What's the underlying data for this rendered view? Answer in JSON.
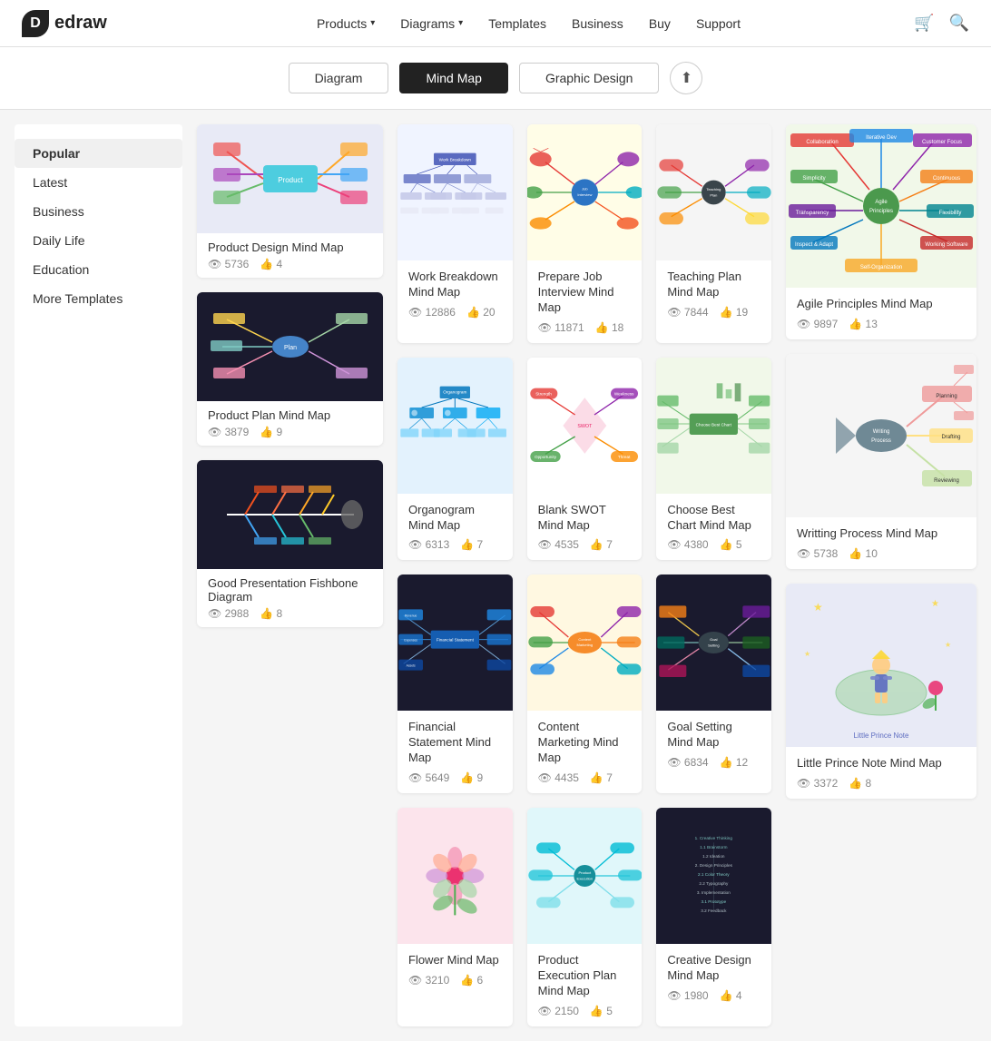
{
  "nav": {
    "logo_text": "edraw",
    "items": [
      {
        "label": "Products",
        "has_chevron": true
      },
      {
        "label": "Diagrams",
        "has_chevron": true
      },
      {
        "label": "Templates",
        "has_chevron": false
      },
      {
        "label": "Business",
        "has_chevron": false
      },
      {
        "label": "Buy",
        "has_chevron": false
      },
      {
        "label": "Support",
        "has_chevron": false
      }
    ]
  },
  "toolbar": {
    "buttons": [
      {
        "label": "Diagram",
        "active": false
      },
      {
        "label": "Mind Map",
        "active": true
      },
      {
        "label": "Graphic Design",
        "active": false
      }
    ],
    "upload_label": "⬆"
  },
  "sidebar": {
    "items": [
      {
        "label": "Popular",
        "active": true
      },
      {
        "label": "Latest",
        "active": false
      },
      {
        "label": "Business",
        "active": false
      },
      {
        "label": "Daily Life",
        "active": false
      },
      {
        "label": "Education",
        "active": false
      },
      {
        "label": "More Templates",
        "active": false
      }
    ]
  },
  "left_cards": [
    {
      "title": "Product Design Mind Map",
      "views": "5736",
      "likes": "4",
      "bg": "#e8eaf6",
      "style": "colorful-branches"
    },
    {
      "title": "Product Plan Mind Map",
      "views": "3879",
      "likes": "9",
      "bg": "#1a1a2e",
      "style": "dark-fishbone"
    },
    {
      "title": "Good Presentation Fishbone Diagram",
      "views": "2988",
      "likes": "8",
      "bg": "#1a1a2e",
      "style": "fishbone"
    }
  ],
  "main_cards": [
    {
      "title": "Work Breakdown Mind Map",
      "views": "12886",
      "likes": "20",
      "bg": "#f0f4ff",
      "style": "hierarchy-blue"
    },
    {
      "title": "Prepare Job Interview Mind Map",
      "views": "11871",
      "likes": "18",
      "bg": "#fff8e1",
      "style": "radial-colorful"
    },
    {
      "title": "Teaching Plan Mind Map",
      "views": "7844",
      "likes": "19",
      "bg": "#f5f5f5",
      "style": "radial-dark"
    },
    {
      "title": "Organogram Mind Map",
      "views": "6313",
      "likes": "7",
      "bg": "#e8f4fd",
      "style": "org-blue"
    },
    {
      "title": "Blank SWOT Mind Map",
      "views": "4535",
      "likes": "7",
      "bg": "#fce4ec",
      "style": "swot-pink"
    },
    {
      "title": "Choose Best Chart Mind Map",
      "views": "4380",
      "likes": "5",
      "bg": "#e8f5e9",
      "style": "chart-green"
    },
    {
      "title": "Financial Statement Mind Map",
      "views": "5649",
      "likes": "9",
      "bg": "#1a1a2e",
      "style": "financial-dark"
    },
    {
      "title": "Content Marketing Mind Map",
      "views": "4435",
      "likes": "7",
      "bg": "#fff3e0",
      "style": "marketing-colorful"
    },
    {
      "title": "Goal Setting Mind Map",
      "views": "6834",
      "likes": "12",
      "bg": "#1a1a2e",
      "style": "goal-dark"
    },
    {
      "title": "Flower Mind Map",
      "views": "3210",
      "likes": "6",
      "bg": "#fce4ec",
      "style": "flower"
    },
    {
      "title": "Product Execution Plan Mind Map",
      "views": "2150",
      "likes": "5",
      "bg": "#e0f7fa",
      "style": "execution-teal"
    },
    {
      "title": "Creative Design Mind Map",
      "views": "1980",
      "likes": "4",
      "bg": "#1a1a2e",
      "style": "creative-dark"
    }
  ],
  "right_cards": [
    {
      "title": "Agile Principles Mind Map",
      "views": "9897",
      "likes": "13",
      "bg": "#e8f5e9",
      "style": "agile-colorful"
    },
    {
      "title": "Writting Process Mind Map",
      "views": "5738",
      "likes": "10",
      "bg": "#f3f3f3",
      "style": "writing-gray"
    },
    {
      "title": "Little Prince Note Mind Map",
      "views": "3372",
      "likes": "8",
      "bg": "#e8eaf6",
      "style": "little-prince"
    }
  ],
  "icons": {
    "eye": "👁",
    "like": "👍",
    "cart": "🛒",
    "search": "🔍",
    "upload": "⬆"
  }
}
